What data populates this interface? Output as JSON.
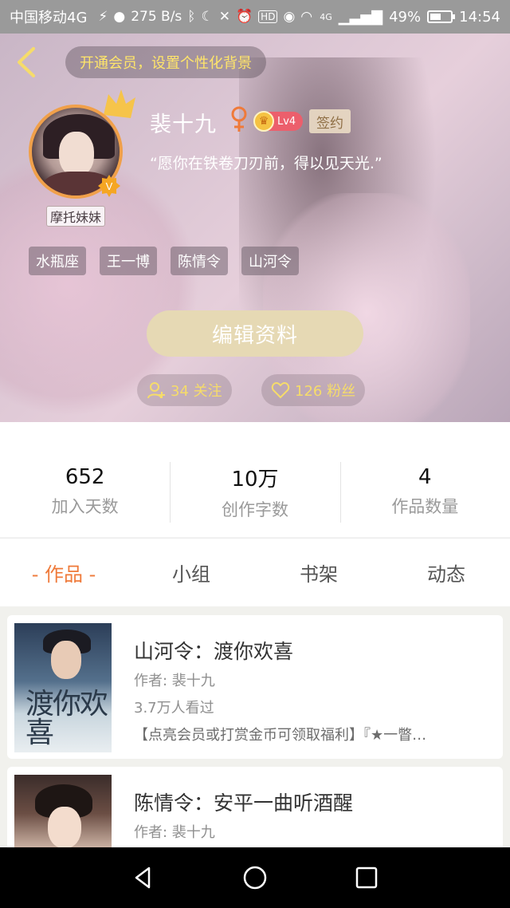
{
  "status_bar": {
    "carrier": "中国移动4G",
    "speed": "275 B/s",
    "network": "4G",
    "battery": "49%",
    "battery_level": 0.49,
    "time": "14:54",
    "icons": [
      "usb-icon",
      "wechat-icon",
      "bluetooth-icon",
      "moon-icon",
      "mute-icon",
      "alarm-icon",
      "hd-icon",
      "eye-icon",
      "wifi-icon",
      "signal-icon",
      "battery-icon"
    ]
  },
  "profile": {
    "vip_banner": "开通会员，设置个性化背景",
    "username": "裴十九",
    "level": "Lv4",
    "signed_badge": "签约",
    "motto": "“愿你在铁卷刀刃前，得以见天光.”",
    "avatar_tag": "摩托妹妹",
    "tags": [
      "水瓶座",
      "王一博",
      "陈情令",
      "山河令"
    ],
    "edit_button": "编辑资料",
    "follow": "34 关注",
    "fans": "126 粉丝"
  },
  "stats": [
    {
      "value": "652",
      "label": "加入天数"
    },
    {
      "value": "10万",
      "label": "创作字数"
    },
    {
      "value": "4",
      "label": "作品数量"
    }
  ],
  "tabs": [
    "- 作品 -",
    "小组",
    "书架",
    "动态"
  ],
  "works": [
    {
      "title": "山河令：渡你欢喜",
      "author": "作者: 裴十九",
      "views": "3.7万人看过",
      "description": "【点亮会员或打赏金币可领取福利】『★一瞥…",
      "cover_text": "渡你欢喜"
    },
    {
      "title": "陈情令：安平一曲听酒醒",
      "author": "作者: 裴十九",
      "views": "",
      "description": ""
    }
  ],
  "colors": {
    "accent": "#ef7a3a",
    "highlight": "#f6dc6a",
    "edit_button": "#e6d9b4",
    "level_badge": "#ec5f6c"
  }
}
